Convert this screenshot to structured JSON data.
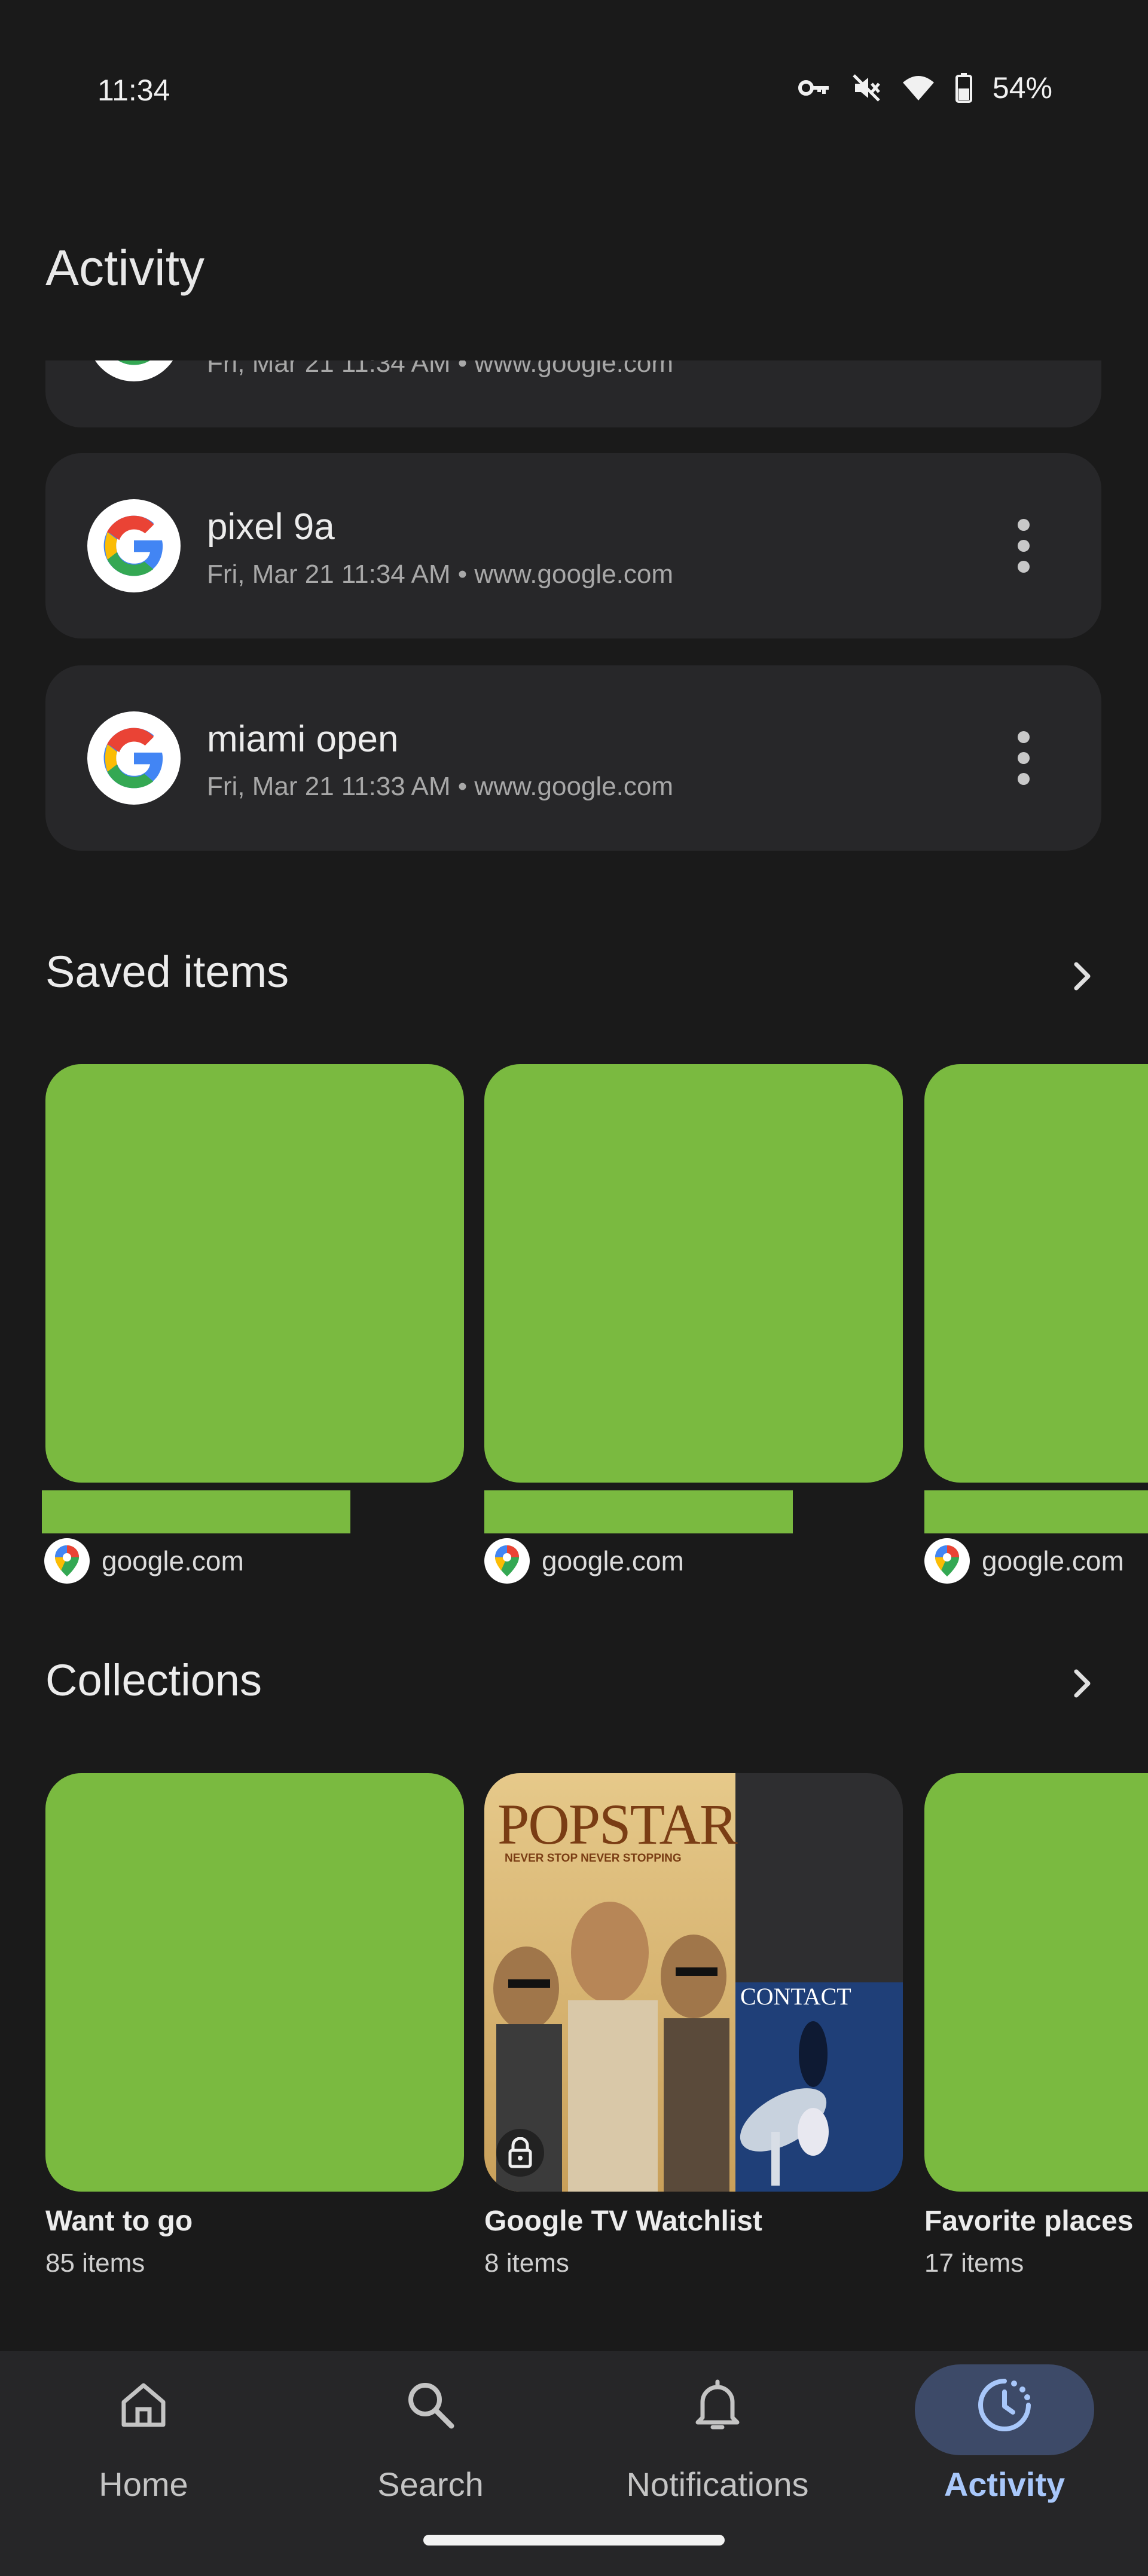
{
  "status_bar": {
    "time": "11:34",
    "battery_percent": "54%",
    "icons": [
      "vpn-key-icon",
      "mute-icon",
      "wifi-icon",
      "battery-icon"
    ]
  },
  "page": {
    "title": "Activity"
  },
  "history": [
    {
      "title": "",
      "meta": "Fri, Mar 21 11:34 AM • www.google.com"
    },
    {
      "title": "pixel 9a",
      "meta": "Fri, Mar 21 11:34 AM • www.google.com"
    },
    {
      "title": "miami open",
      "meta": "Fri, Mar 21 11:33 AM • www.google.com"
    }
  ],
  "saved": {
    "title": "Saved items",
    "items": [
      {
        "source": "google.com"
      },
      {
        "source": "google.com"
      },
      {
        "source": "google.com"
      }
    ]
  },
  "collections": {
    "title": "Collections",
    "items": [
      {
        "name": "Want to go",
        "count": "85 items"
      },
      {
        "name": "Google TV Watchlist",
        "count": "8 items",
        "poster_main": "POPSTAR",
        "poster_tagline": "NEVER STOP NEVER STOPPING",
        "poster_second": "CONTACT"
      },
      {
        "name": "Favorite places",
        "count": "17 items"
      }
    ]
  },
  "nav": {
    "items": [
      {
        "label": "Home",
        "icon": "home-icon"
      },
      {
        "label": "Search",
        "icon": "search-icon"
      },
      {
        "label": "Notifications",
        "icon": "bell-icon"
      },
      {
        "label": "Activity",
        "icon": "activity-icon",
        "active": true
      }
    ]
  },
  "colors": {
    "background": "#1a1a1a",
    "card": "#272729",
    "redaction": "#7aba40",
    "accent": "#a8c7fa"
  }
}
